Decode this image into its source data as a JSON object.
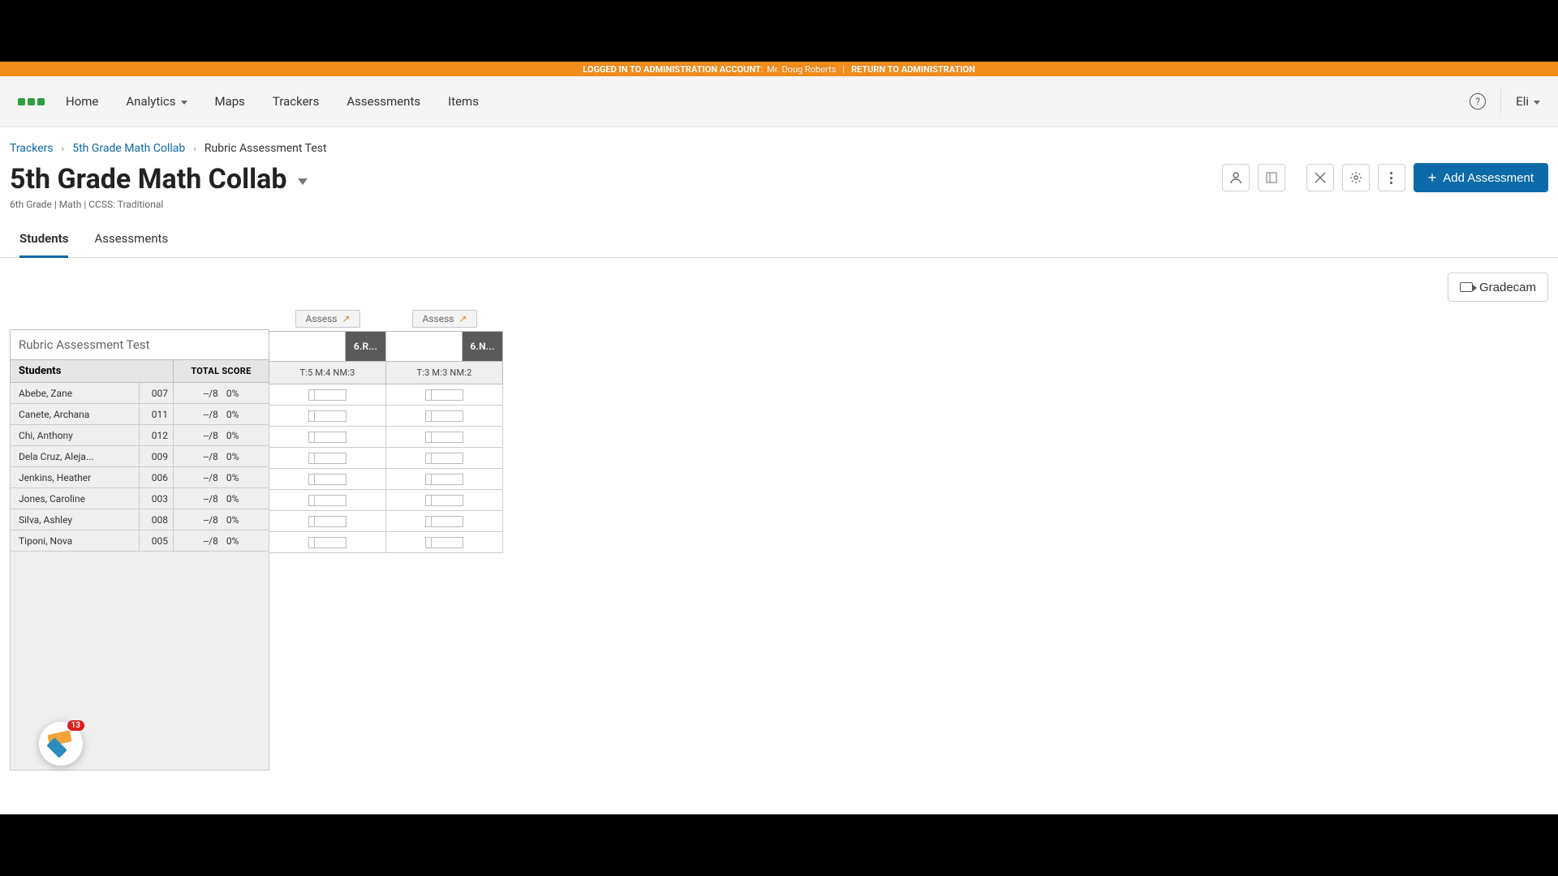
{
  "banner": {
    "prefix": "LOGGED IN TO ADMINISTRATION ACCOUNT",
    "user": "Mr. Doug Roberts",
    "return": "RETURN TO ADMINISTRATION"
  },
  "nav": {
    "items": [
      "Home",
      "Analytics",
      "Maps",
      "Trackers",
      "Assessments",
      "Items"
    ],
    "user": "Eli"
  },
  "breadcrumb": [
    "Trackers",
    "5th Grade Math Collab",
    "Rubric Assessment Test"
  ],
  "page": {
    "title": "5th Grade Math Collab",
    "subtitle": "6th Grade  |  Math  |  CCSS: Traditional",
    "add_btn": "Add Assessment"
  },
  "tabs": [
    "Students",
    "Assessments"
  ],
  "toolbar": {
    "gradecam": "Gradecam"
  },
  "grid": {
    "assessment_name": "Rubric Assessment Test",
    "students_header": "Students",
    "total_header": "TOTAL SCORE",
    "assess_label": "Assess",
    "columns": [
      {
        "standard": "6.R...",
        "stats": "T:5  M:4  NM:3"
      },
      {
        "standard": "6.N...",
        "stats": "T:3  M:3  NM:2"
      }
    ],
    "students": [
      {
        "name": "Abebe, Zane",
        "id": "007",
        "score": "--/8",
        "pct": "0%"
      },
      {
        "name": "Canete, Archana",
        "id": "011",
        "score": "--/8",
        "pct": "0%"
      },
      {
        "name": "Chi, Anthony",
        "id": "012",
        "score": "--/8",
        "pct": "0%"
      },
      {
        "name": "Dela Cruz, Aleja...",
        "id": "009",
        "score": "--/8",
        "pct": "0%"
      },
      {
        "name": "Jenkins, Heather",
        "id": "006",
        "score": "--/8",
        "pct": "0%"
      },
      {
        "name": "Jones, Caroline",
        "id": "003",
        "score": "--/8",
        "pct": "0%"
      },
      {
        "name": "Silva, Ashley",
        "id": "008",
        "score": "--/8",
        "pct": "0%"
      },
      {
        "name": "Tiponi, Nova",
        "id": "005",
        "score": "--/8",
        "pct": "0%"
      }
    ]
  },
  "widget": {
    "count": "13"
  }
}
